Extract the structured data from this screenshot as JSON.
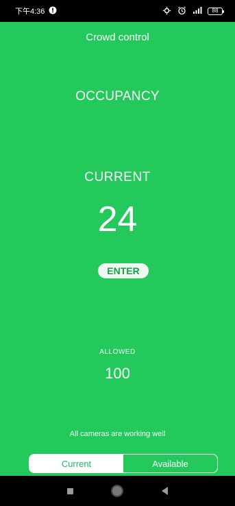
{
  "status_bar": {
    "time": "下午4:36",
    "notification_icon": "alert-circle-icon",
    "icons": [
      "settings-icon",
      "alarm-icon",
      "signal-icon"
    ],
    "battery_level": "88"
  },
  "app": {
    "title": "Crowd control",
    "section_title": "OCCUPANCY",
    "current_label": "CURRENT",
    "current_value": "24",
    "enter_label": "ENTER",
    "allowed_label": "ALLOWED",
    "allowed_value": "100",
    "status_message": "All cameras are working well",
    "tabs": [
      {
        "label": "Current",
        "active": true
      },
      {
        "label": "Available",
        "active": false
      }
    ],
    "colors": {
      "background": "#23c95b",
      "enter_button_bg": "#eef8f0",
      "enter_button_text": "#1a9e49",
      "active_tab_bg": "#ffffff",
      "active_tab_text": "#23b85a"
    }
  },
  "nav_bar": {
    "buttons": [
      "recent-apps-icon",
      "home-icon",
      "back-icon"
    ]
  }
}
